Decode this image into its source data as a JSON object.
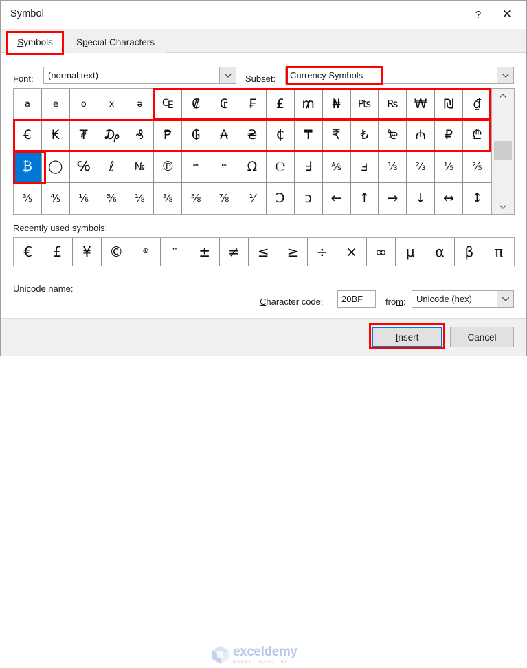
{
  "dialog": {
    "title": "Symbol",
    "help_icon": "question-mark-icon",
    "close_icon": "close-x-icon"
  },
  "tabs": [
    {
      "label": "Symbols",
      "mnemonic": "S",
      "active": true
    },
    {
      "label": "Special Characters",
      "mnemonic": "p",
      "active": false
    }
  ],
  "font_row": {
    "label": "Font:",
    "value": "(normal text)"
  },
  "subset_row": {
    "label": "Subset:",
    "value": "Currency Symbols"
  },
  "symbol_grid": {
    "selected_index": 34,
    "rows": [
      [
        {
          "ch": "a",
          "cls": "lbl"
        },
        {
          "ch": "e",
          "cls": "lbl"
        },
        {
          "ch": "o",
          "cls": "lbl"
        },
        {
          "ch": "x",
          "cls": "lbl"
        },
        {
          "ch": "ə",
          "cls": "lbl"
        },
        {
          "ch": "₠",
          "cls": ""
        },
        {
          "ch": "₡",
          "cls": ""
        },
        {
          "ch": "₢",
          "cls": ""
        },
        {
          "ch": "₣",
          "cls": ""
        },
        {
          "ch": "£",
          "cls": ""
        },
        {
          "ch": "₥",
          "cls": ""
        },
        {
          "ch": "₦",
          "cls": ""
        },
        {
          "ch": "₧",
          "cls": "tiny"
        },
        {
          "ch": "₨",
          "cls": "tiny"
        },
        {
          "ch": "₩",
          "cls": ""
        },
        {
          "ch": "₪",
          "cls": ""
        },
        {
          "ch": "₫",
          "cls": ""
        }
      ],
      [
        {
          "ch": "€",
          "cls": ""
        },
        {
          "ch": "₭",
          "cls": ""
        },
        {
          "ch": "₮",
          "cls": ""
        },
        {
          "ch": "₯",
          "cls": ""
        },
        {
          "ch": "₰",
          "cls": ""
        },
        {
          "ch": "₱",
          "cls": ""
        },
        {
          "ch": "₲",
          "cls": ""
        },
        {
          "ch": "₳",
          "cls": ""
        },
        {
          "ch": "₴",
          "cls": ""
        },
        {
          "ch": "₵",
          "cls": ""
        },
        {
          "ch": "₸",
          "cls": ""
        },
        {
          "ch": "₹",
          "cls": ""
        },
        {
          "ch": "₺",
          "cls": ""
        },
        {
          "ch": "₻",
          "cls": ""
        },
        {
          "ch": "₼",
          "cls": ""
        },
        {
          "ch": "₽",
          "cls": ""
        },
        {
          "ch": "₾",
          "cls": ""
        }
      ],
      [
        {
          "ch": "₿",
          "cls": ""
        },
        {
          "ch": "◯",
          "cls": ""
        },
        {
          "ch": "℅",
          "cls": ""
        },
        {
          "ch": "ℓ",
          "cls": ""
        },
        {
          "ch": "№",
          "cls": "tiny"
        },
        {
          "ch": "℗",
          "cls": ""
        },
        {
          "ch": "℠",
          "cls": "small"
        },
        {
          "ch": "™",
          "cls": "small"
        },
        {
          "ch": "Ω",
          "cls": ""
        },
        {
          "ch": "℮",
          "cls": ""
        },
        {
          "ch": "Ⅎ",
          "cls": ""
        },
        {
          "ch": "⅍",
          "cls": "tiny"
        },
        {
          "ch": "ⅎ",
          "cls": ""
        },
        {
          "ch": "⅓",
          "cls": "tiny"
        },
        {
          "ch": "⅔",
          "cls": "tiny"
        },
        {
          "ch": "⅕",
          "cls": "tiny"
        },
        {
          "ch": "⅖",
          "cls": "tiny"
        }
      ],
      [
        {
          "ch": "⅗",
          "cls": "tiny"
        },
        {
          "ch": "⅘",
          "cls": "tiny"
        },
        {
          "ch": "⅙",
          "cls": "tiny"
        },
        {
          "ch": "⅚",
          "cls": "tiny"
        },
        {
          "ch": "⅛",
          "cls": "tiny"
        },
        {
          "ch": "⅜",
          "cls": "tiny"
        },
        {
          "ch": "⅝",
          "cls": "tiny"
        },
        {
          "ch": "⅞",
          "cls": "tiny"
        },
        {
          "ch": "⅟",
          "cls": "tiny"
        },
        {
          "ch": "Ↄ",
          "cls": ""
        },
        {
          "ch": "ↄ",
          "cls": ""
        },
        {
          "ch": "←",
          "cls": ""
        },
        {
          "ch": "↑",
          "cls": ""
        },
        {
          "ch": "→",
          "cls": ""
        },
        {
          "ch": "↓",
          "cls": ""
        },
        {
          "ch": "↔",
          "cls": ""
        },
        {
          "ch": "↕",
          "cls": ""
        }
      ]
    ],
    "scrollbar": {
      "up_icon": "chevron-up-icon",
      "down_icon": "chevron-down-icon"
    }
  },
  "recent": {
    "label": "Recently used symbols:",
    "symbols": [
      {
        "ch": "€",
        "cls": ""
      },
      {
        "ch": "£",
        "cls": ""
      },
      {
        "ch": "¥",
        "cls": ""
      },
      {
        "ch": "©",
        "cls": ""
      },
      {
        "ch": "®",
        "cls": "small"
      },
      {
        "ch": "™",
        "cls": "small"
      },
      {
        "ch": "±",
        "cls": ""
      },
      {
        "ch": "≠",
        "cls": ""
      },
      {
        "ch": "≤",
        "cls": ""
      },
      {
        "ch": "≥",
        "cls": ""
      },
      {
        "ch": "÷",
        "cls": ""
      },
      {
        "ch": "×",
        "cls": ""
      },
      {
        "ch": "∞",
        "cls": ""
      },
      {
        "ch": "µ",
        "cls": ""
      },
      {
        "ch": "α",
        "cls": ""
      },
      {
        "ch": "β",
        "cls": ""
      },
      {
        "ch": "π",
        "cls": ""
      }
    ]
  },
  "unicode_row": {
    "name_label": "Unicode name:",
    "name_value": "",
    "charcode_label": "Character code:",
    "charcode_value": "20BF",
    "from_label": "from:",
    "from_value": "Unicode (hex)"
  },
  "footer": {
    "insert_label": "Insert",
    "cancel_label": "Cancel"
  },
  "watermark": {
    "name": "exceldemy",
    "tagline": "EXCEL - DATA - BI"
  },
  "annotations": {
    "color": "#ff0000",
    "targets": [
      "symbols-tab",
      "subset-value",
      "grid-row1-currency",
      "grid-row2-currency",
      "grid-bitcoin-cell",
      "insert-button"
    ]
  }
}
